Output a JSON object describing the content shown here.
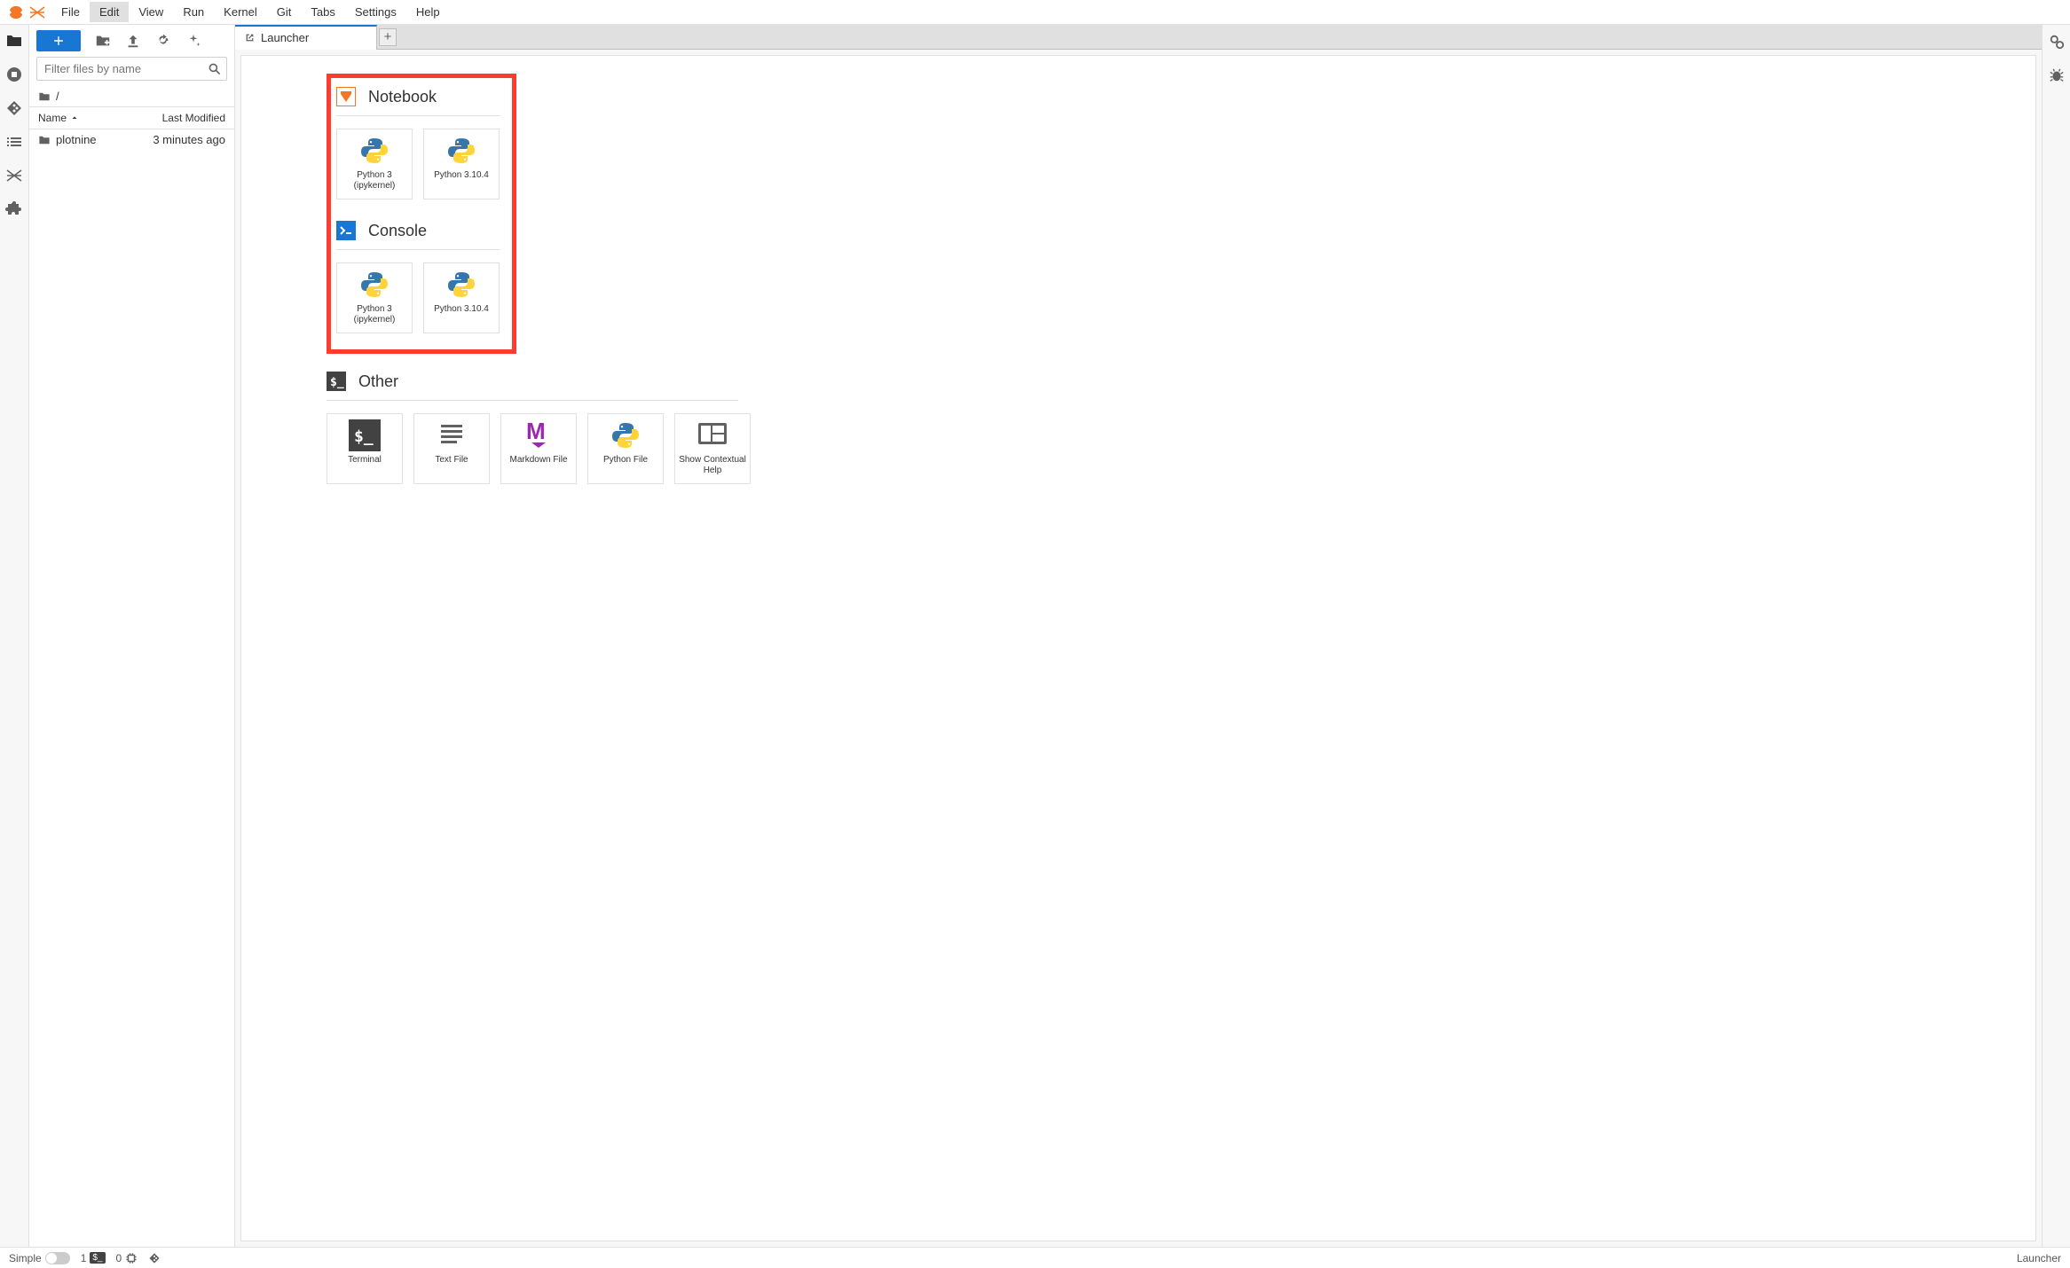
{
  "menubar": {
    "items": [
      "File",
      "Edit",
      "View",
      "Run",
      "Kernel",
      "Git",
      "Tabs",
      "Settings",
      "Help"
    ],
    "active_index": 1
  },
  "filebrowser": {
    "filter_placeholder": "Filter files by name",
    "breadcrumb": "/",
    "columns": {
      "name": "Name",
      "modified": "Last Modified"
    },
    "rows": [
      {
        "name": "plotnine",
        "modified": "3 minutes ago",
        "type": "folder"
      }
    ]
  },
  "tabs": {
    "active": "Launcher"
  },
  "launcher": {
    "sections": {
      "notebook": {
        "title": "Notebook",
        "cards": [
          {
            "label": "Python 3 (ipykernel)",
            "icon": "python"
          },
          {
            "label": "Python 3.10.4",
            "icon": "python"
          }
        ]
      },
      "console": {
        "title": "Console",
        "cards": [
          {
            "label": "Python 3 (ipykernel)",
            "icon": "python"
          },
          {
            "label": "Python 3.10.4",
            "icon": "python"
          }
        ]
      },
      "other": {
        "title": "Other",
        "cards": [
          {
            "label": "Terminal",
            "icon": "terminal"
          },
          {
            "label": "Text File",
            "icon": "textfile"
          },
          {
            "label": "Markdown File",
            "icon": "markdown"
          },
          {
            "label": "Python File",
            "icon": "python"
          },
          {
            "label": "Show Contextual Help",
            "icon": "help"
          }
        ]
      }
    }
  },
  "statusbar": {
    "simple_label": "Simple",
    "terminal_count": "1",
    "kernel_count": "0",
    "right": "Launcher"
  }
}
